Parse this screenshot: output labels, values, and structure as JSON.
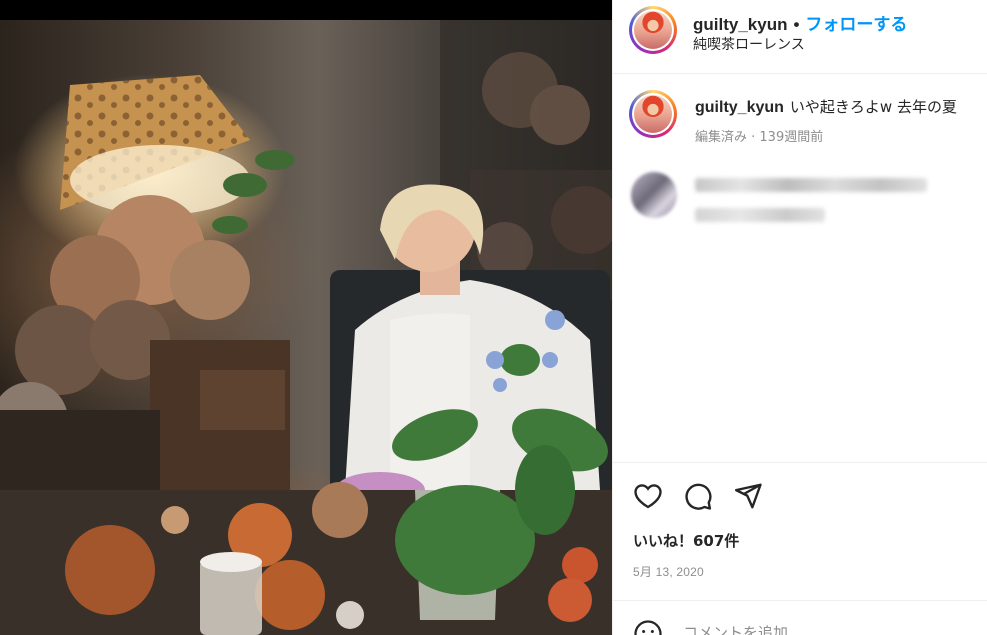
{
  "post": {
    "username": "guilty_kyun",
    "separator": "•",
    "follow_label": "フォローする",
    "location": "純喫茶ローレンス"
  },
  "caption": {
    "username": "guilty_kyun",
    "text": "いや起きろよw 去年の夏",
    "edited": "編集済み · 139週間前"
  },
  "icons": {
    "like": "heart-icon",
    "comment": "speech-bubble-icon",
    "share": "paper-plane-icon",
    "emoji": "smiley-icon"
  },
  "engagement": {
    "likes_text": "いいね！607件",
    "date": "5月 13, 2020"
  },
  "add_comment": {
    "placeholder": "コメントを追加..."
  },
  "colors": {
    "accent": "#0095f6",
    "text": "#262626",
    "muted": "#8e8e8e",
    "divider": "#efefef"
  }
}
